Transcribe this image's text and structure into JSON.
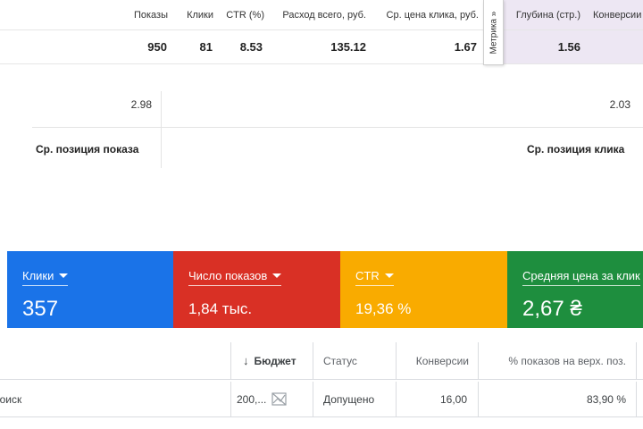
{
  "yandex_table": {
    "headers": [
      "Показы",
      "Клики",
      "CTR (%)",
      "Расход всего, руб.",
      "Ср. цена клика, руб.",
      "Глубина (стр.)",
      "Конверсии"
    ],
    "values": [
      "950",
      "81",
      "8.53",
      "135.12",
      "1.67",
      "1.56",
      ""
    ],
    "metrika_tab": "Метрика »"
  },
  "positions": {
    "show_value": "2.98",
    "click_value": "2.03",
    "show_label": "Ср. позиция показа",
    "click_label": "Ср. позиция клика"
  },
  "cards": [
    {
      "title": "Клики",
      "value": "357",
      "color": "#1a73e8"
    },
    {
      "title": "Число показов",
      "value": "1,84 тыс.",
      "color": "#d93025"
    },
    {
      "title": "CTR",
      "value": "19,36 %",
      "color": "#f9ab00"
    },
    {
      "title": "Средняя цена за клик",
      "value": "2,67 ₴",
      "color": "#1e8e3e"
    }
  ],
  "google_table": {
    "headers": {
      "budget": "Бюджет",
      "status": "Статус",
      "conversions": "Конверсии",
      "top_impr": "% показов на верх. поз."
    },
    "row": {
      "campaign": "Поиск",
      "budget": "200,...",
      "status": "Допущено",
      "conversions": "16,00",
      "top_impr": "83,90 %"
    }
  }
}
